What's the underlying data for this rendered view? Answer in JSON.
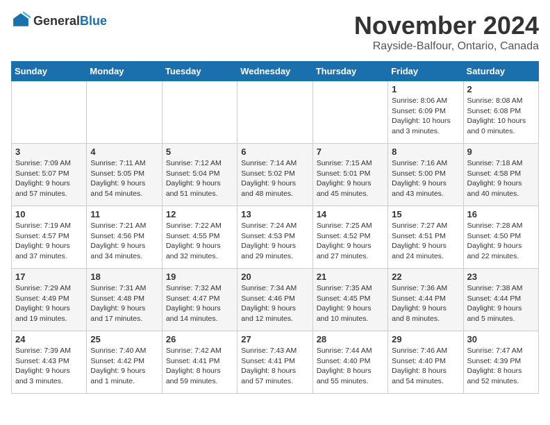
{
  "logo": {
    "general": "General",
    "blue": "Blue"
  },
  "header": {
    "month": "November 2024",
    "location": "Rayside-Balfour, Ontario, Canada"
  },
  "weekdays": [
    "Sunday",
    "Monday",
    "Tuesday",
    "Wednesday",
    "Thursday",
    "Friday",
    "Saturday"
  ],
  "weeks": [
    [
      {
        "day": "",
        "info": ""
      },
      {
        "day": "",
        "info": ""
      },
      {
        "day": "",
        "info": ""
      },
      {
        "day": "",
        "info": ""
      },
      {
        "day": "",
        "info": ""
      },
      {
        "day": "1",
        "info": "Sunrise: 8:06 AM\nSunset: 6:09 PM\nDaylight: 10 hours and 3 minutes."
      },
      {
        "day": "2",
        "info": "Sunrise: 8:08 AM\nSunset: 6:08 PM\nDaylight: 10 hours and 0 minutes."
      }
    ],
    [
      {
        "day": "3",
        "info": "Sunrise: 7:09 AM\nSunset: 5:07 PM\nDaylight: 9 hours and 57 minutes."
      },
      {
        "day": "4",
        "info": "Sunrise: 7:11 AM\nSunset: 5:05 PM\nDaylight: 9 hours and 54 minutes."
      },
      {
        "day": "5",
        "info": "Sunrise: 7:12 AM\nSunset: 5:04 PM\nDaylight: 9 hours and 51 minutes."
      },
      {
        "day": "6",
        "info": "Sunrise: 7:14 AM\nSunset: 5:02 PM\nDaylight: 9 hours and 48 minutes."
      },
      {
        "day": "7",
        "info": "Sunrise: 7:15 AM\nSunset: 5:01 PM\nDaylight: 9 hours and 45 minutes."
      },
      {
        "day": "8",
        "info": "Sunrise: 7:16 AM\nSunset: 5:00 PM\nDaylight: 9 hours and 43 minutes."
      },
      {
        "day": "9",
        "info": "Sunrise: 7:18 AM\nSunset: 4:58 PM\nDaylight: 9 hours and 40 minutes."
      }
    ],
    [
      {
        "day": "10",
        "info": "Sunrise: 7:19 AM\nSunset: 4:57 PM\nDaylight: 9 hours and 37 minutes."
      },
      {
        "day": "11",
        "info": "Sunrise: 7:21 AM\nSunset: 4:56 PM\nDaylight: 9 hours and 34 minutes."
      },
      {
        "day": "12",
        "info": "Sunrise: 7:22 AM\nSunset: 4:55 PM\nDaylight: 9 hours and 32 minutes."
      },
      {
        "day": "13",
        "info": "Sunrise: 7:24 AM\nSunset: 4:53 PM\nDaylight: 9 hours and 29 minutes."
      },
      {
        "day": "14",
        "info": "Sunrise: 7:25 AM\nSunset: 4:52 PM\nDaylight: 9 hours and 27 minutes."
      },
      {
        "day": "15",
        "info": "Sunrise: 7:27 AM\nSunset: 4:51 PM\nDaylight: 9 hours and 24 minutes."
      },
      {
        "day": "16",
        "info": "Sunrise: 7:28 AM\nSunset: 4:50 PM\nDaylight: 9 hours and 22 minutes."
      }
    ],
    [
      {
        "day": "17",
        "info": "Sunrise: 7:29 AM\nSunset: 4:49 PM\nDaylight: 9 hours and 19 minutes."
      },
      {
        "day": "18",
        "info": "Sunrise: 7:31 AM\nSunset: 4:48 PM\nDaylight: 9 hours and 17 minutes."
      },
      {
        "day": "19",
        "info": "Sunrise: 7:32 AM\nSunset: 4:47 PM\nDaylight: 9 hours and 14 minutes."
      },
      {
        "day": "20",
        "info": "Sunrise: 7:34 AM\nSunset: 4:46 PM\nDaylight: 9 hours and 12 minutes."
      },
      {
        "day": "21",
        "info": "Sunrise: 7:35 AM\nSunset: 4:45 PM\nDaylight: 9 hours and 10 minutes."
      },
      {
        "day": "22",
        "info": "Sunrise: 7:36 AM\nSunset: 4:44 PM\nDaylight: 9 hours and 8 minutes."
      },
      {
        "day": "23",
        "info": "Sunrise: 7:38 AM\nSunset: 4:44 PM\nDaylight: 9 hours and 5 minutes."
      }
    ],
    [
      {
        "day": "24",
        "info": "Sunrise: 7:39 AM\nSunset: 4:43 PM\nDaylight: 9 hours and 3 minutes."
      },
      {
        "day": "25",
        "info": "Sunrise: 7:40 AM\nSunset: 4:42 PM\nDaylight: 9 hours and 1 minute."
      },
      {
        "day": "26",
        "info": "Sunrise: 7:42 AM\nSunset: 4:41 PM\nDaylight: 8 hours and 59 minutes."
      },
      {
        "day": "27",
        "info": "Sunrise: 7:43 AM\nSunset: 4:41 PM\nDaylight: 8 hours and 57 minutes."
      },
      {
        "day": "28",
        "info": "Sunrise: 7:44 AM\nSunset: 4:40 PM\nDaylight: 8 hours and 55 minutes."
      },
      {
        "day": "29",
        "info": "Sunrise: 7:46 AM\nSunset: 4:40 PM\nDaylight: 8 hours and 54 minutes."
      },
      {
        "day": "30",
        "info": "Sunrise: 7:47 AM\nSunset: 4:39 PM\nDaylight: 8 hours and 52 minutes."
      }
    ]
  ]
}
